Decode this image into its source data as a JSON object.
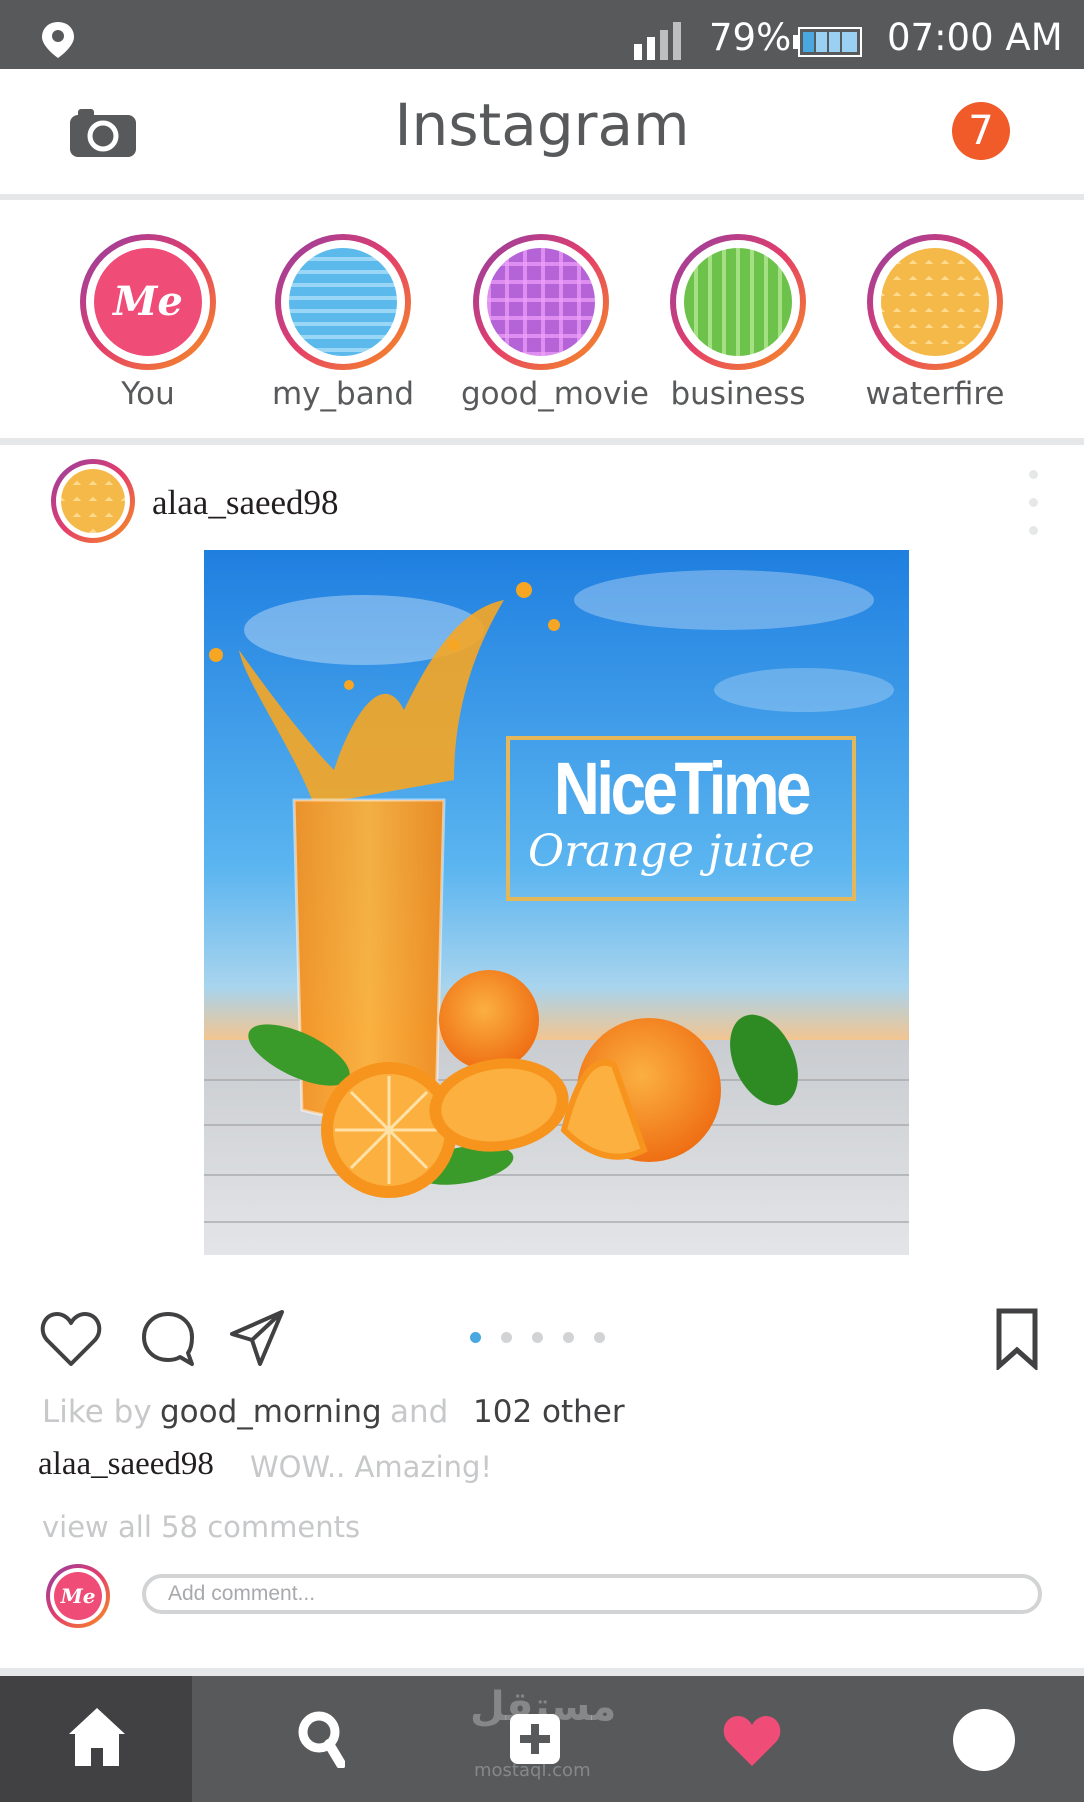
{
  "status_bar": {
    "battery_percent": "79%",
    "time": "07:00 AM",
    "icons": [
      "location-pin-icon",
      "signal-icon",
      "battery-icon"
    ]
  },
  "header": {
    "title": "Instagram",
    "notification_count": "7",
    "icons": [
      "camera-icon"
    ],
    "accent_color": "#f15a29"
  },
  "stories": [
    {
      "label": "You",
      "avatar_text": "Me"
    },
    {
      "label": "my_band"
    },
    {
      "label": "good_movie"
    },
    {
      "label": "business"
    },
    {
      "label": "waterfire"
    }
  ],
  "post": {
    "username": "alaa_saeed98",
    "image": {
      "brand_title": "NiceTime",
      "brand_subtitle": "Orange juice"
    },
    "carousel": {
      "count": 5,
      "active_index": 0
    },
    "likes": {
      "prefix": "Like by",
      "user": "good_morning",
      "connector": "and",
      "others": "102 other"
    },
    "caption": {
      "user": "alaa_saeed98",
      "text": "WOW.. Amazing!"
    },
    "comments_link": "view all 58 comments",
    "comment_input": {
      "placeholder": "Add comment...",
      "avatar_text": "Me"
    },
    "icons": [
      "heart-icon",
      "comment-icon",
      "share-icon",
      "bookmark-icon"
    ]
  },
  "bottom_nav": {
    "items": [
      "home",
      "search",
      "add",
      "activity",
      "profile"
    ],
    "active": "home",
    "activity_color": "#ef4c78",
    "watermark": "مستقل",
    "watermark_url": "mostaql.com"
  }
}
